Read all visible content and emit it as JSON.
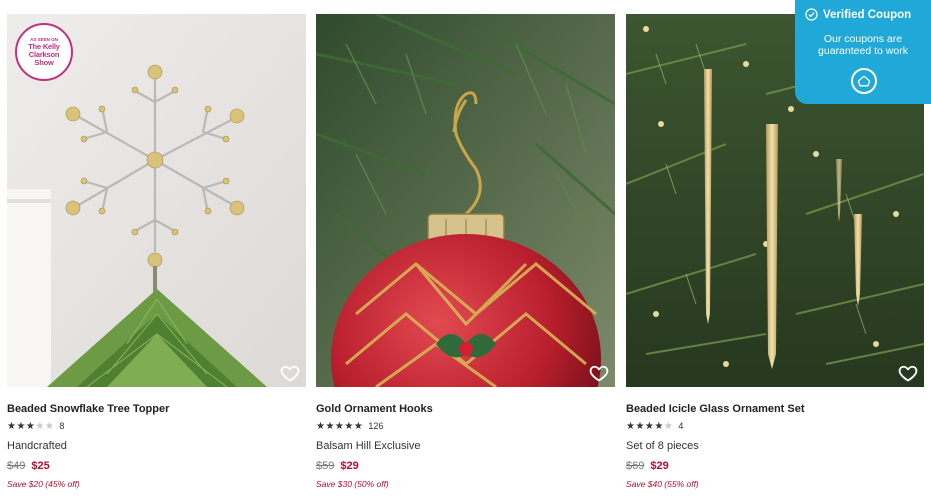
{
  "products": [
    {
      "name": "Beaded Snowflake Tree Topper",
      "rating": 3,
      "review_count": "8",
      "description": "Handcrafted",
      "old_price": "$49",
      "price": "$25",
      "savings": "Save $20 (45% off)",
      "badge": {
        "line1": "AS SEEN ON",
        "line2": "The Kelly",
        "line3": "Clarkson",
        "line4": "Show"
      }
    },
    {
      "name": "Gold Ornament Hooks",
      "rating": 5,
      "review_count": "126",
      "description": "Balsam Hill Exclusive",
      "old_price": "$59",
      "price": "$29",
      "savings": "Save $30 (50% off)"
    },
    {
      "name": "Beaded Icicle Glass Ornament Set",
      "rating": 4,
      "review_count": "4",
      "description": "Set of 8 pieces",
      "old_price": "$69",
      "price": "$29",
      "savings": "Save $40 (55% off)"
    }
  ],
  "coupon": {
    "title": "Verified Coupon",
    "message": "Our coupons are guaranteed to work",
    "icons": [
      "check-circle-icon",
      "home-logo-icon"
    ]
  },
  "colors": {
    "sale": "#b3102b",
    "coupon_bg": "#20a8d8",
    "badge": "#c2307d"
  }
}
